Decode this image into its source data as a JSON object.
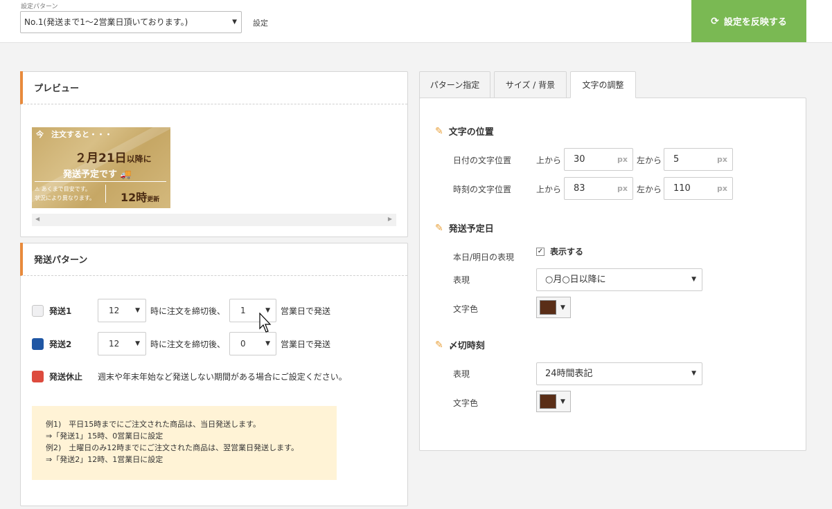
{
  "topbar": {
    "pattern_caption": "設定パターン",
    "pattern_value": "No.1(発送まで1〜2営業日頂いております。)",
    "settings_link": "設定",
    "apply_label": "設定を反映する",
    "apply_icon": "refresh-icon"
  },
  "preview": {
    "title": "プレビュー",
    "banner": {
      "now_text": "今　注文すると・・・",
      "date_text": "２月21日",
      "date_suffix": "以降に",
      "ship_text": "発送予定です",
      "note_line1": "あくまで目安です。",
      "note_line2": "状況により異なります。",
      "time_text": "12時",
      "time_suffix": "更新"
    }
  },
  "shipping": {
    "title": "発送パターン",
    "rows": [
      {
        "label": "発送1",
        "hour": "12",
        "mid_text": "時に注文を締切後、",
        "days": "1",
        "end_text": "営業日で発送",
        "color": "#f0f0f2"
      },
      {
        "label": "発送2",
        "hour": "12",
        "mid_text": "時に注文を締切後、",
        "days": "0",
        "end_text": "営業日で発送",
        "color": "#1f56a4"
      }
    ],
    "rest": {
      "label": "発送休止",
      "text": "週末や年末年始など発送しない期間がある場合にご設定ください。",
      "color": "#dd4b3e"
    },
    "example_lines": [
      "例1)　平日15時までにご注文された商品は、当日発送します。",
      "⇒「発送1」15時、0営業日に設定",
      "例2)　土曜日のみ12時までにご注文された商品は、翌営業日発送します。",
      "⇒「発送2」12時、1営業日に設定"
    ]
  },
  "tabs": [
    {
      "label": "パターン指定"
    },
    {
      "label": "サイズ / 背景"
    },
    {
      "label": "文字の調整"
    }
  ],
  "text_position": {
    "title": "文字の位置",
    "date_label": "日付の文字位置",
    "time_label": "時刻の文字位置",
    "top_label": "上から",
    "left_label": "左から",
    "unit": "px",
    "date_top": "30",
    "date_left": "5",
    "time_top": "83",
    "time_left": "110"
  },
  "ship_date": {
    "title": "発送予定日",
    "today_label": "本日/明日の表現",
    "show_label": "表示する",
    "expression_label": "表現",
    "expression_value": "○月○日以降に",
    "color_label": "文字色",
    "color": "#5a2e17"
  },
  "cutoff": {
    "title": "〆切時刻",
    "expression_label": "表現",
    "expression_value": "24時間表記",
    "color_label": "文字色",
    "color": "#5a2e17"
  },
  "colors": {
    "accent_green": "#7ab953",
    "panel_accent": "#e88a3c",
    "pencil": "#e8a13c",
    "note_bg": "#fff3d6"
  }
}
